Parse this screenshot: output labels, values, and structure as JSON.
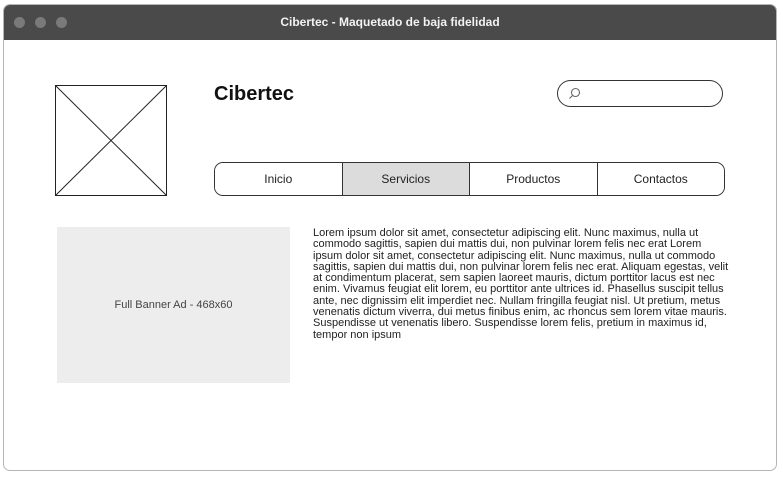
{
  "window": {
    "title": "Cibertec - Maquetado de baja fidelidad"
  },
  "header": {
    "brand": "Cibertec",
    "search": {
      "placeholder": "",
      "value": ""
    }
  },
  "nav": {
    "tabs": [
      {
        "label": "Inicio",
        "active": false
      },
      {
        "label": "Servicios",
        "active": true
      },
      {
        "label": "Productos",
        "active": false
      },
      {
        "label": "Contactos",
        "active": false
      }
    ]
  },
  "main": {
    "banner_label": "Full Banner Ad - 468x60",
    "body_text": "Lorem ipsum dolor sit amet, consectetur adipiscing elit. Nunc maximus, nulla ut commodo sagittis, sapien dui mattis dui, non pulvinar lorem felis nec erat Lorem ipsum dolor sit amet, consectetur adipiscing elit. Nunc maximus, nulla ut commodo sagittis, sapien dui mattis dui, non pulvinar lorem felis nec erat. Aliquam egestas, velit at condimentum placerat, sem sapien laoreet mauris, dictum porttitor lacus est nec enim. Vivamus feugiat elit lorem, eu porttitor ante ultrices id. Phasellus suscipit tellus ante, nec dignissim elit imperdiet nec. Nullam fringilla feugiat nisl. Ut pretium, metus venenatis dictum viverra, dui metus finibus enim, ac rhoncus sem lorem vitae mauris. Suspendisse ut venenatis libero. Suspendisse lorem felis, pretium in maximus id, tempor non ipsum"
  },
  "colors": {
    "titlebar": "#4a4a4a",
    "active_tab": "#dcdcdc",
    "banner_bg": "#ededed"
  }
}
